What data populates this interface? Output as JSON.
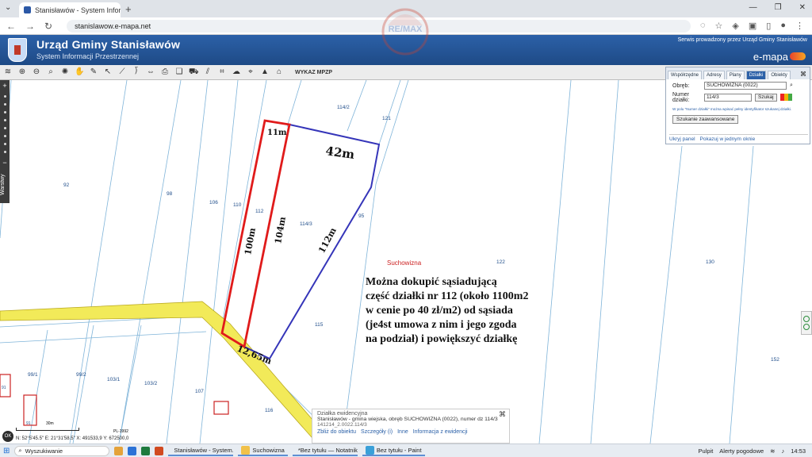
{
  "browser": {
    "tab_title": "Stanisławów - System Informacji",
    "new_tab": "+",
    "url": "stanislawow.e-mapa.net",
    "window_controls": [
      "—",
      "❐",
      "✕"
    ]
  },
  "watermark": "RE/MAX",
  "header": {
    "title": "Urząd Gminy Stanisławów",
    "subtitle": "System Informacji Przestrzennej",
    "service_note": "Serwis prowadzony przez Urząd Gminy Stanisławów",
    "brand": "e-mapa"
  },
  "toolbar": {
    "icons": [
      "layers-icon",
      "zoom-in-icon",
      "zoom-out-icon",
      "zoom-rect-icon",
      "zoom-full-icon",
      "pan-icon",
      "pencil-icon",
      "pointer-icon",
      "measure-line-icon",
      "measure-area-icon",
      "arrows-icon",
      "print-icon",
      "copy-icon",
      "car-icon",
      "hatch-icon",
      "tag-icon",
      "cloud-icon",
      "pin-icon",
      "mountain-icon",
      "home-icon"
    ],
    "wykaz_label": "WYKAZ MPZP"
  },
  "sidenav": {
    "layers_label": "Warstwy"
  },
  "panel": {
    "tabs": [
      "Współrzędne",
      "Adresy",
      "Plany",
      "Działki",
      "Obiekty"
    ],
    "active_tab": "Działki",
    "obreb_label": "Obręb:",
    "obreb_value": "SUCHOWIZNA (0022)",
    "numer_label": "Numer działki:",
    "numer_value": "114/3",
    "search_button": "Szukaj",
    "hint": "W polu \"Numer działki\" można wpisać pełny identyfikator szukanej działki.",
    "advanced_button": "Szukanie zaawansowane",
    "link_hide": "Ukryj panel",
    "link_show": "Pokazuj w jednym oknie"
  },
  "map": {
    "locality": "Suchowizna",
    "parcels": [
      "114/2",
      "121",
      "92",
      "98",
      "106",
      "110",
      "112",
      "114/3",
      "95",
      "122",
      "130",
      "115",
      "152",
      "99/1",
      "99/2",
      "103/1",
      "103/2",
      "107",
      "116",
      "91",
      "91"
    ],
    "dimensions": {
      "top_red": "11m",
      "top_blue": "42m",
      "left_red": "100m",
      "middle": "104m",
      "right": "112m",
      "bottom": "12,65m"
    },
    "note": "Można dokupić sąsiadującą\nczęść działki nr 112 (około 1100m2\nw cenie po 40 zł/m2) od sąsiada\n(je4st umowa z nim i jego zgoda\nna podział) i powiększyć działkę"
  },
  "info_box": {
    "title": "Działka ewidencyjna",
    "line1": "Stanisławów - gmina wiejska, obręb SUCHOWIZNA (0022), numer dz 114/3",
    "line2": "141214_2.0022.114/3",
    "links": [
      "Zbliż do obiektu",
      "Szczegóły (i)",
      "Inne",
      "Informacja z ewidencji"
    ]
  },
  "status": {
    "scale_label": "30m",
    "crs": "PL-1992",
    "coords": "N: 52°5'45.5\" E: 21°31'58.5\"  X: 491533,9  Y: 672500,0",
    "ok": "OK"
  },
  "taskbar": {
    "search": "Wyszukiwanie",
    "tasks": [
      "Stanisławów - System...",
      "Suchowizna",
      "*Bez tytułu — Notatnik",
      "Bez tytułu - Paint"
    ],
    "widgets": [
      "Pulpit",
      "Alerty pogodowe"
    ],
    "time": "14:53"
  }
}
